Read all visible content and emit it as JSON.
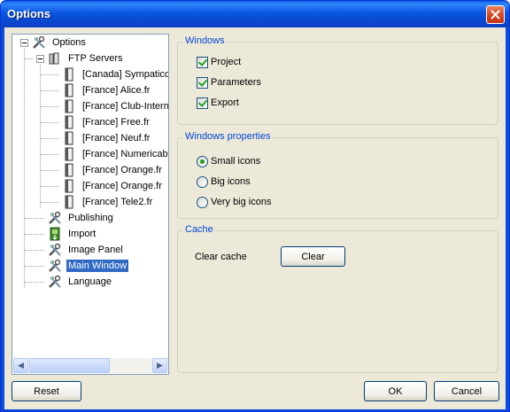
{
  "window": {
    "title": "Options"
  },
  "tree": {
    "root": {
      "label": "Options",
      "icon": "tools-icon"
    },
    "ftp": {
      "label": "FTP Servers",
      "icon": "servers-icon"
    },
    "servers": [
      "[Canada] Sympatico",
      "[France] Alice.fr",
      "[France] Club-Internet",
      "[France] Free.fr",
      "[France] Neuf.fr",
      "[France] Numericable",
      "[France] Orange.fr",
      "[France] Orange.fr",
      "[France] Tele2.fr"
    ],
    "items": [
      {
        "label": "Publishing",
        "icon": "tools-icon"
      },
      {
        "label": "Import",
        "icon": "import-icon"
      },
      {
        "label": "Image Panel",
        "icon": "tools-icon"
      },
      {
        "label": "Main Window",
        "icon": "tools-icon",
        "selected": true
      },
      {
        "label": "Language",
        "icon": "tools-icon"
      }
    ]
  },
  "windows_group": {
    "title": "Windows",
    "options": [
      {
        "label": "Project",
        "checked": true
      },
      {
        "label": "Parameters",
        "checked": true
      },
      {
        "label": "Export",
        "checked": true
      }
    ]
  },
  "properties_group": {
    "title": "Windows properties",
    "options": [
      {
        "label": "Small icons",
        "selected": true
      },
      {
        "label": "Big icons",
        "selected": false
      },
      {
        "label": "Very big icons",
        "selected": false
      }
    ]
  },
  "cache_group": {
    "title": "Cache",
    "label": "Clear cache",
    "button": "Clear"
  },
  "buttons": {
    "reset": "Reset",
    "ok": "OK",
    "cancel": "Cancel"
  }
}
